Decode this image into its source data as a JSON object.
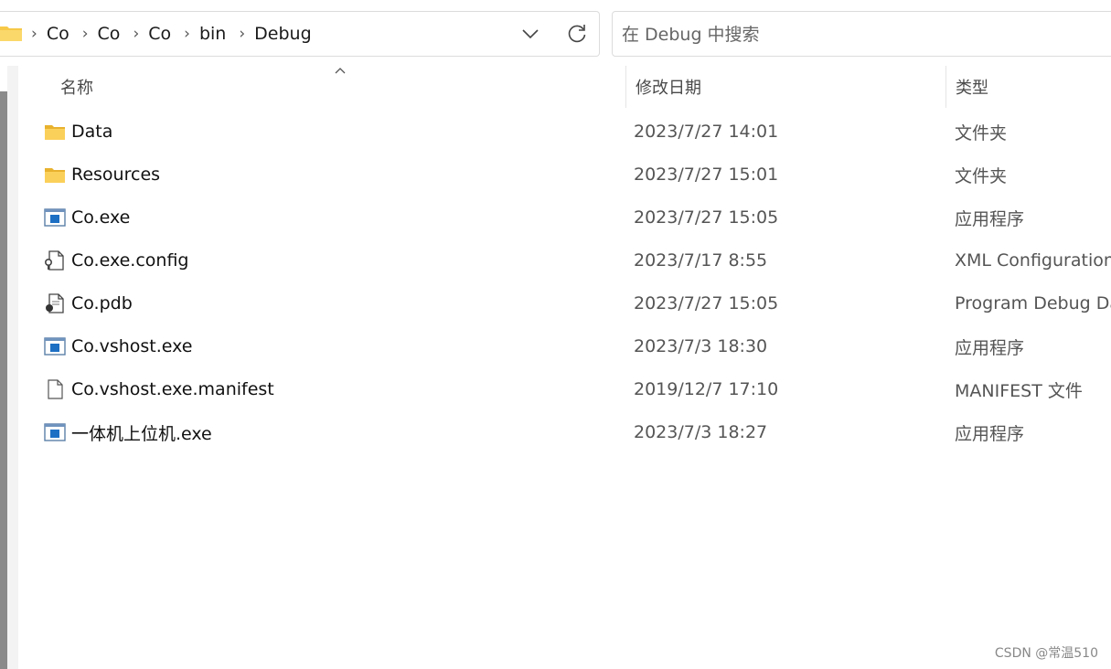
{
  "address_bar": {
    "breadcrumbs": [
      "Co",
      "Co",
      "Co",
      "bin",
      "Debug"
    ],
    "separator": "›"
  },
  "search": {
    "placeholder": "在 Debug 中搜索"
  },
  "columns": {
    "name": "名称",
    "date": "修改日期",
    "type": "类型"
  },
  "files": [
    {
      "name": "Data",
      "date": "2023/7/27 14:01",
      "type": "文件夹",
      "icon": "folder-icon"
    },
    {
      "name": "Resources",
      "date": "2023/7/27 15:01",
      "type": "文件夹",
      "icon": "folder-icon"
    },
    {
      "name": "Co.exe",
      "date": "2023/7/27 15:05",
      "type": "应用程序",
      "icon": "exe-icon"
    },
    {
      "name": "Co.exe.config",
      "date": "2023/7/17 8:55",
      "type": "XML Configuration File",
      "icon": "config-file-icon"
    },
    {
      "name": "Co.pdb",
      "date": "2023/7/27 15:05",
      "type": "Program Debug Database",
      "icon": "pdb-file-icon"
    },
    {
      "name": "Co.vshost.exe",
      "date": "2023/7/3 18:30",
      "type": "应用程序",
      "icon": "exe-icon"
    },
    {
      "name": "Co.vshost.exe.manifest",
      "date": "2019/12/7 17:10",
      "type": "MANIFEST 文件",
      "icon": "blank-file-icon"
    },
    {
      "name": "一体机上位机.exe",
      "date": "2023/7/3 18:27",
      "type": "应用程序",
      "icon": "exe-icon"
    }
  ],
  "watermark": "CSDN @常温510",
  "colors": {
    "folder": "#f7c948",
    "exe_blue": "#1d6fc4",
    "border": "#dcdcdc"
  }
}
